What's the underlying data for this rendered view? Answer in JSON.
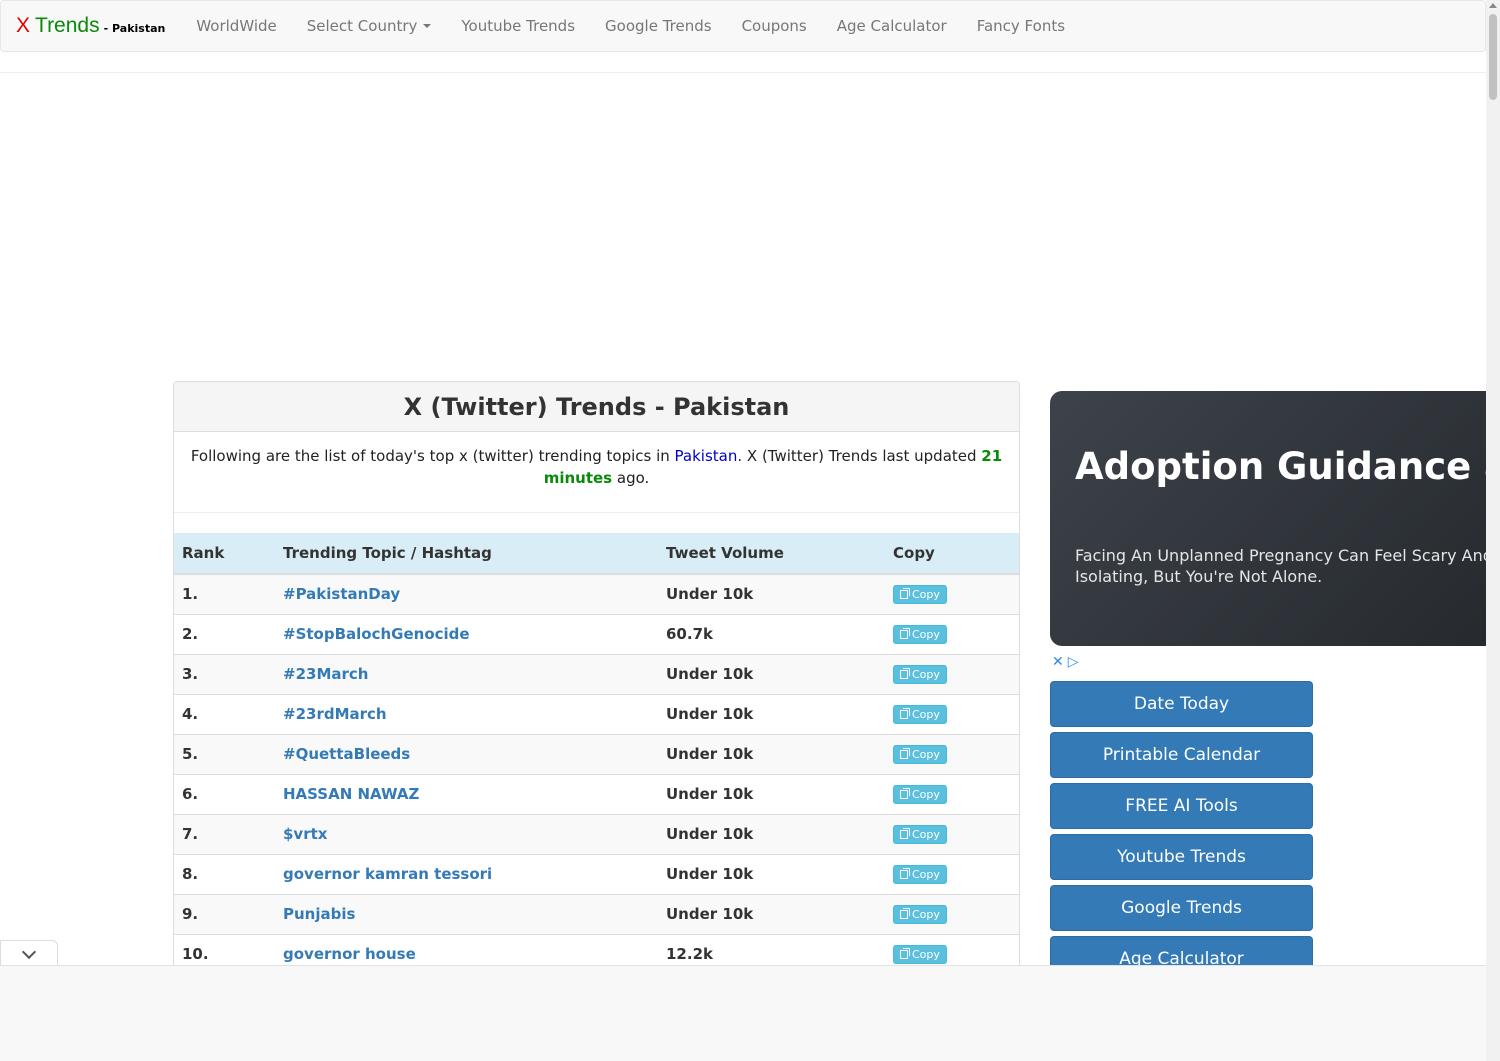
{
  "nav": {
    "brand_x": "X",
    "brand_trends": "Trends",
    "brand_country": "- Pakistan",
    "items": [
      "WorldWide",
      "Select Country",
      "Youtube Trends",
      "Google Trends",
      "Coupons",
      "Age Calculator",
      "Fancy Fonts"
    ]
  },
  "panel": {
    "title": "X (Twitter) Trends - Pakistan",
    "intro_before": "Following are the list of today's top x (twitter) trending topics in ",
    "country": "Pakistan",
    "intro_middle": ". X (Twitter) Trends last updated ",
    "updated": "21 minutes",
    "intro_after": " ago."
  },
  "table": {
    "headers": [
      "Rank",
      "Trending Topic / Hashtag",
      "Tweet Volume",
      "Copy"
    ],
    "copy_label": "Copy",
    "rows": [
      {
        "rank": "1.",
        "topic": "#PakistanDay",
        "volume": "Under 10k"
      },
      {
        "rank": "2.",
        "topic": "#StopBalochGenocide",
        "volume": "60.7k"
      },
      {
        "rank": "3.",
        "topic": "#23March",
        "volume": "Under 10k"
      },
      {
        "rank": "4.",
        "topic": "#23rdMarch",
        "volume": "Under 10k"
      },
      {
        "rank": "5.",
        "topic": "#QuettaBleeds",
        "volume": "Under 10k"
      },
      {
        "rank": "6.",
        "topic": "HASSAN NAWAZ",
        "volume": "Under 10k"
      },
      {
        "rank": "7.",
        "topic": "$vrtx",
        "volume": "Under 10k"
      },
      {
        "rank": "8.",
        "topic": "governor kamran tessori",
        "volume": "Under 10k"
      },
      {
        "rank": "9.",
        "topic": "Punjabis",
        "volume": "Under 10k"
      },
      {
        "rank": "10.",
        "topic": "governor house",
        "volume": "12.2k"
      }
    ]
  },
  "ad": {
    "title": "Adoption Guidance and",
    "text": "Facing An Unplanned Pregnancy Can Feel Scary And Isolating, But You're Not Alone.",
    "close_icon": "close-icon",
    "adchoices_icon": "adchoices-icon"
  },
  "side_buttons": [
    "Date Today",
    "Printable Calendar",
    "FREE AI Tools",
    "Youtube Trends",
    "Google Trends",
    "Age Calculator"
  ],
  "colors": {
    "brand_red": "#e00000",
    "brand_green": "#0a8a0a",
    "link_blue": "#337ab7",
    "table_header_bg": "#d9edf7",
    "copy_button": "#5bc0de",
    "side_button": "#337ab7"
  }
}
